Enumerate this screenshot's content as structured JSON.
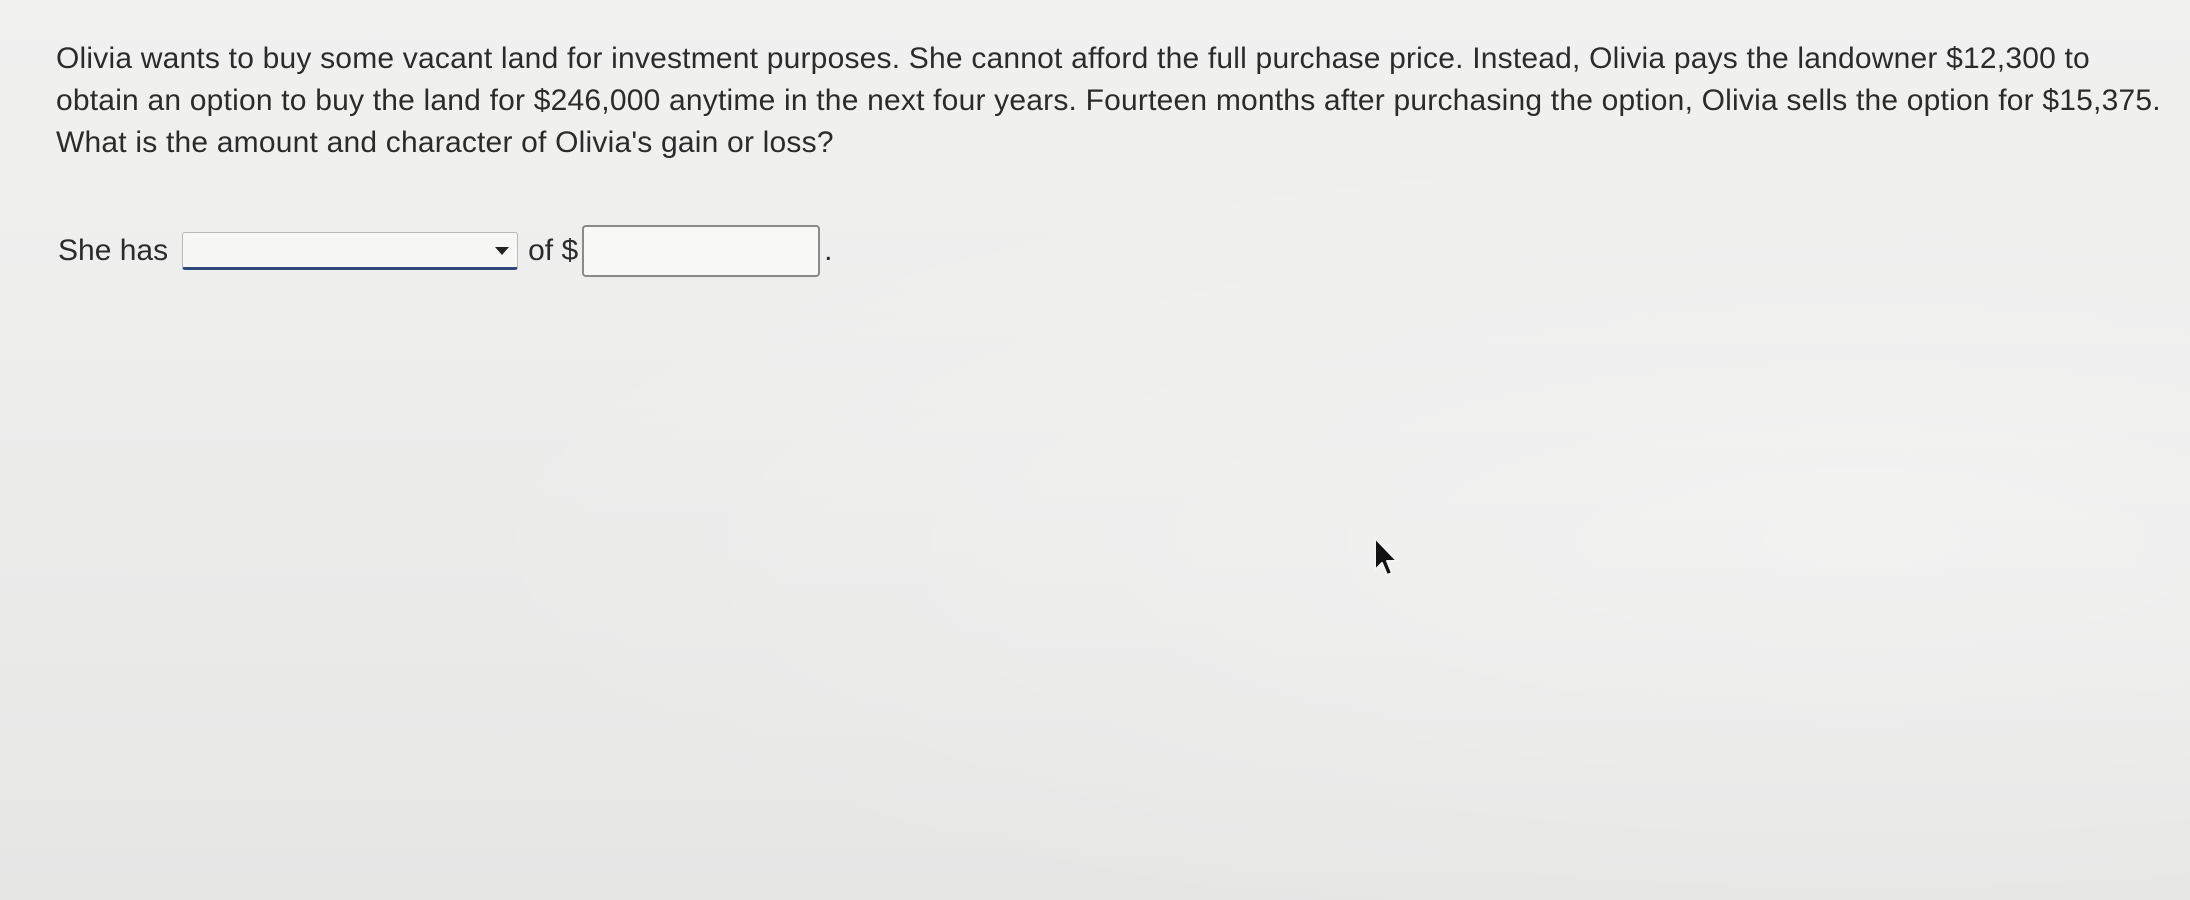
{
  "question": {
    "text": "Olivia wants to buy some vacant land for investment purposes. She cannot afford the full purchase price. Instead, Olivia pays the landowner $12,300 to obtain an option to buy the land for $246,000 anytime in the next four years. Fourteen months after purchasing the option, Olivia sells the option for $15,375. What is the amount and character of Olivia's gain or loss?"
  },
  "answer": {
    "prefix": "She has",
    "character_select_value": "",
    "middle": "of $",
    "amount_value": "",
    "suffix": "."
  },
  "icons": {
    "dropdown": "chevron-down-icon",
    "pointer": "mouse-pointer-icon"
  }
}
